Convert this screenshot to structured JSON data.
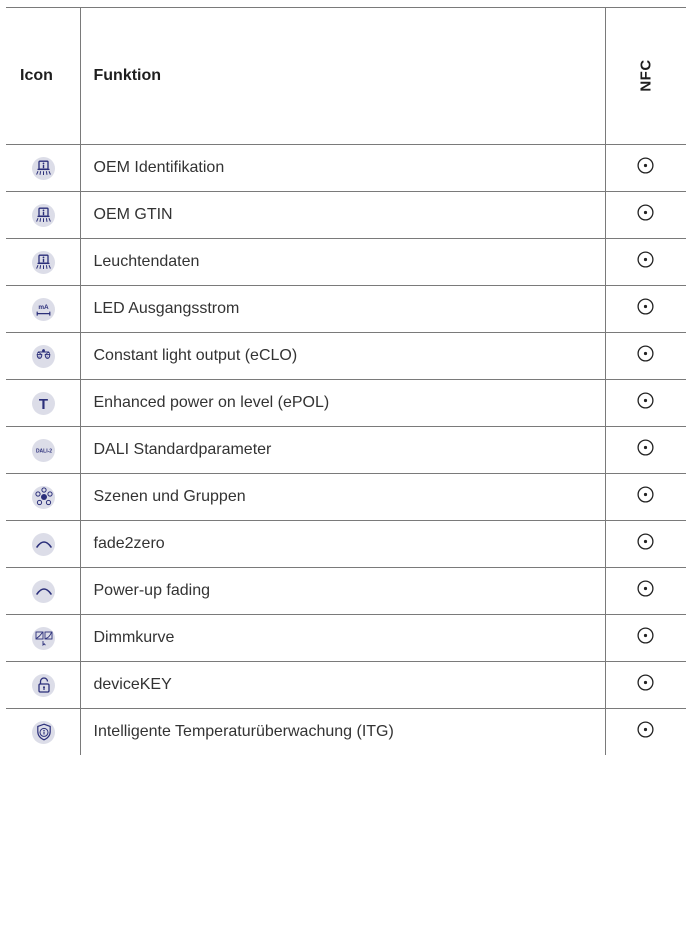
{
  "table": {
    "headers": {
      "icon": "Icon",
      "function": "Funktion",
      "nfc": "NFC"
    },
    "rows": [
      {
        "icon": "luminaire-info-icon",
        "label": "OEM Identifikation",
        "nfc": true
      },
      {
        "icon": "luminaire-info-icon",
        "label": "OEM GTIN",
        "nfc": true
      },
      {
        "icon": "luminaire-info-icon",
        "label": "Leuchtendaten",
        "nfc": true
      },
      {
        "icon": "output-current-icon",
        "icon_text": "mA",
        "label": "LED Ausgangsstrom",
        "nfc": true
      },
      {
        "icon": "constant-light-output-icon",
        "label": "Constant light output (eCLO)",
        "nfc": true
      },
      {
        "icon": "power-on-level-icon",
        "icon_text": "T",
        "label": "Enhanced power on level (ePOL)",
        "nfc": true
      },
      {
        "icon": "dali-2-icon",
        "icon_text": "DALI-2",
        "label": "DALI Standardparameter",
        "nfc": true
      },
      {
        "icon": "scenes-groups-icon",
        "label": "Szenen und Gruppen",
        "nfc": true
      },
      {
        "icon": "fade-curve-icon",
        "label": "fade2zero",
        "nfc": true
      },
      {
        "icon": "fade-curve-icon",
        "label": "Power-up fading",
        "nfc": true
      },
      {
        "icon": "dimming-curve-icon",
        "label": "Dimmkurve",
        "nfc": true
      },
      {
        "icon": "padlock-icon",
        "label": "deviceKEY",
        "nfc": true
      },
      {
        "icon": "shield-info-icon",
        "label": "Intelligente Temperaturüberwachung (ITG)",
        "nfc": true
      }
    ]
  },
  "colors": {
    "icon_background": "#dcdde8",
    "icon_foreground": "#2b2f7a",
    "rule": "#7a7a7a"
  }
}
